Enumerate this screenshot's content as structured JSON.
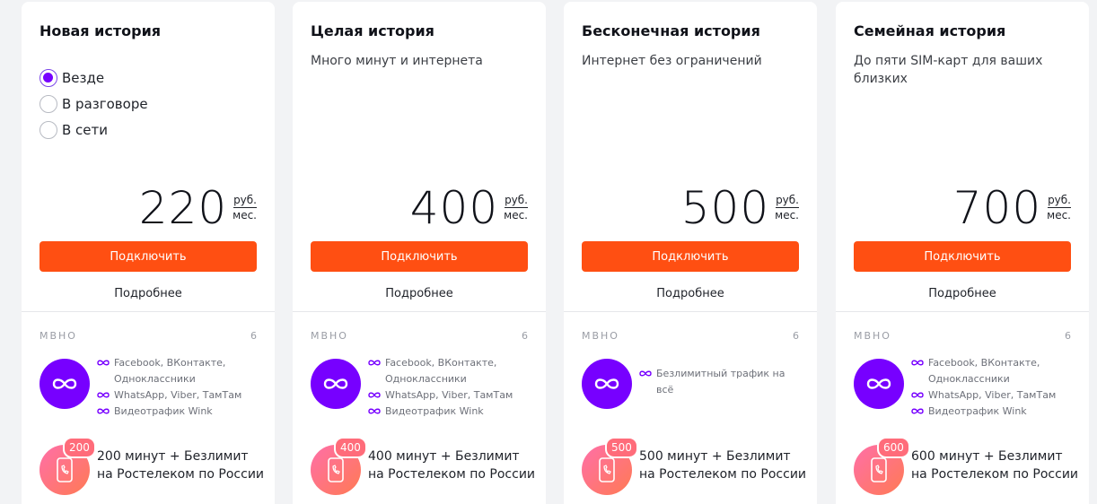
{
  "colors": {
    "accent": "#7700ff",
    "button": "#ff4f12",
    "minutes_gradient": [
      "#ff6fa8",
      "#ff7a54"
    ]
  },
  "radio_options": [
    {
      "label": "Везде",
      "selected": true
    },
    {
      "label": "В разговоре",
      "selected": false
    },
    {
      "label": "В сети",
      "selected": false
    }
  ],
  "cards": [
    {
      "title": "Новая история",
      "subtitle": "",
      "price": "220",
      "currency": "руб.",
      "period": "мес.",
      "button": "Подключить",
      "more": "Подробнее",
      "section_label": "МВНО",
      "section_count": "6",
      "features": [
        "Facebook, ВКонтакте, Одноклассники",
        "WhatsApp, Viber, ТамТам",
        "Видеотрафик Wink"
      ],
      "minutes_badge": "200",
      "minutes_text": "200 минут + Безлимит на Ростелеком по России"
    },
    {
      "title": "Целая история",
      "subtitle": "Много минут и интернета",
      "price": "400",
      "currency": "руб.",
      "period": "мес.",
      "button": "Подключить",
      "more": "Подробнее",
      "section_label": "МВНО",
      "section_count": "6",
      "features": [
        "Facebook, ВКонтакте, Одноклассники",
        "WhatsApp, Viber, ТамТам",
        "Видеотрафик Wink"
      ],
      "minutes_badge": "400",
      "minutes_text": "400 минут + Безлимит на Ростелеком по России"
    },
    {
      "title": "Бесконечная история",
      "subtitle": "Интернет без ограничений",
      "price": "500",
      "currency": "руб.",
      "period": "мес.",
      "button": "Подключить",
      "more": "Подробнее",
      "section_label": "МВНО",
      "section_count": "6",
      "features": [
        "Безлимитный трафик на всё"
      ],
      "minutes_badge": "500",
      "minutes_text": "500 минут + Безлимит на Ростелеком по России"
    },
    {
      "title": "Семейная история",
      "subtitle": "До пяти SIM-карт для ваших близких",
      "price": "700",
      "currency": "руб.",
      "period": "мес.",
      "button": "Подключить",
      "more": "Подробнее",
      "section_label": "МВНО",
      "section_count": "6",
      "features": [
        "Facebook, ВКонтакте, Одноклассники",
        "WhatsApp, Viber, ТамТам",
        "Видеотрафик Wink"
      ],
      "minutes_badge": "600",
      "minutes_text": "600 минут + Безлимит на Ростелеком по России"
    }
  ]
}
